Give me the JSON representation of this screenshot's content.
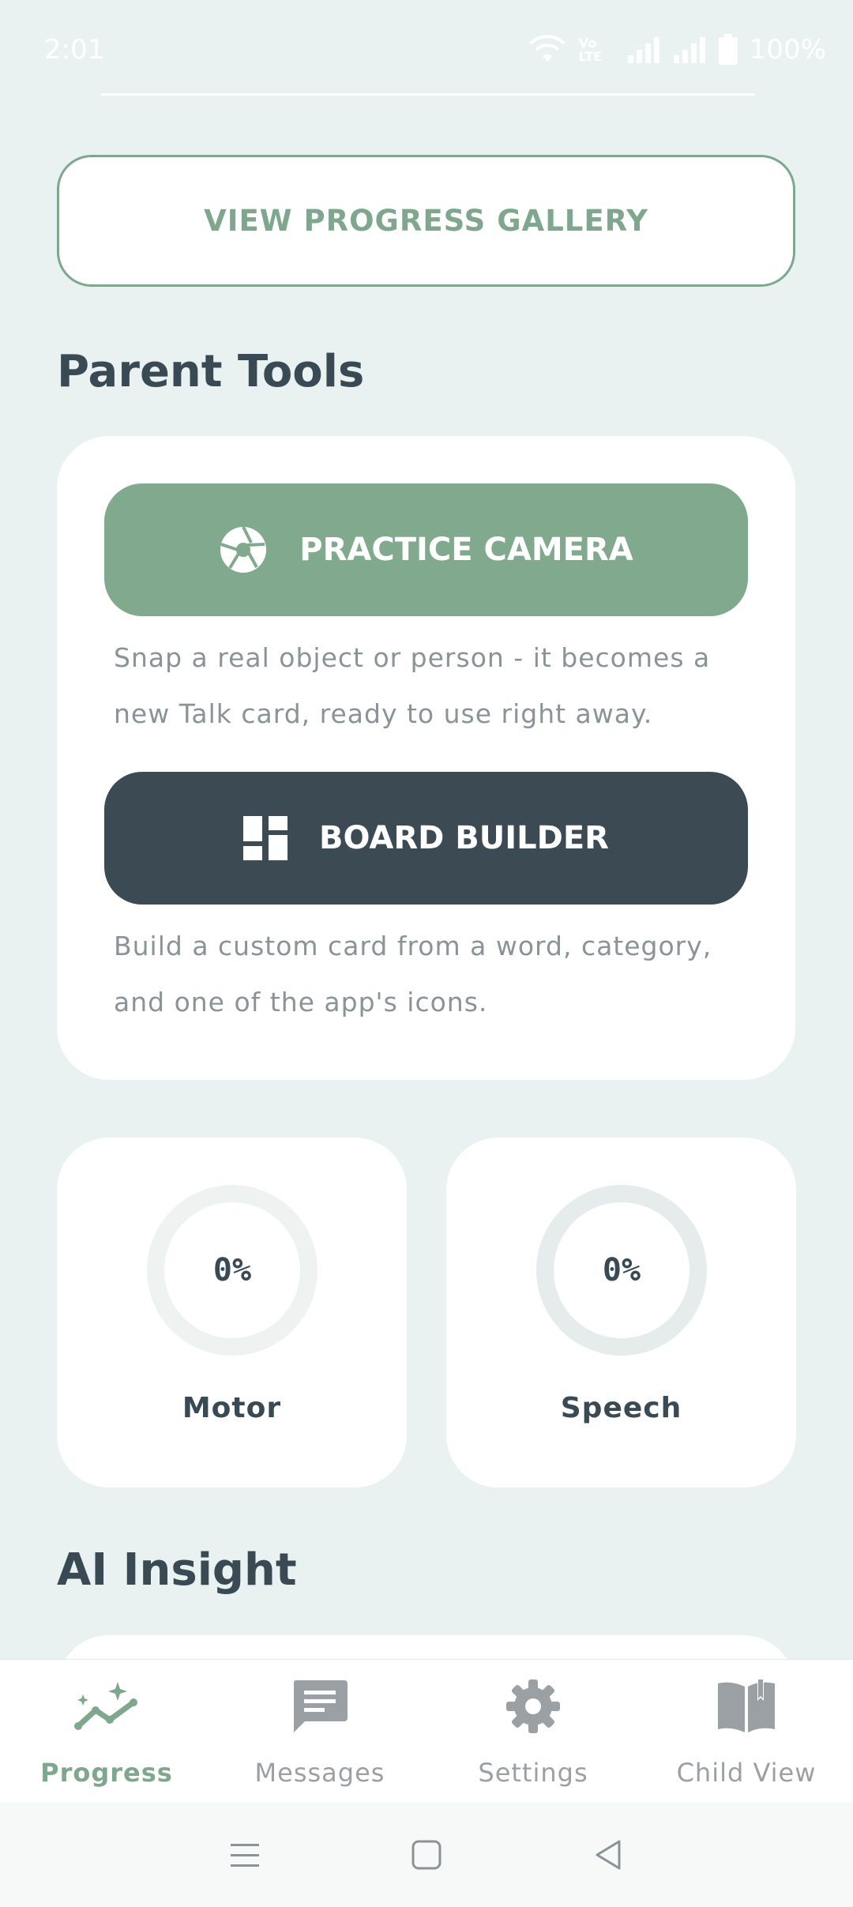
{
  "status_bar": {
    "time": "2:01",
    "network": "Vo LTE",
    "battery": "100%"
  },
  "gallery_button": {
    "label": "VIEW PROGRESS GALLERY"
  },
  "parent_tools": {
    "title": "Parent Tools",
    "camera": {
      "label": "PRACTICE CAMERA",
      "description": "Snap a real object or person - it becomes a new Talk card, ready to use right away."
    },
    "builder": {
      "label": "BOARD BUILDER",
      "description": "Build a custom card from a word, category, and one of the app's icons."
    }
  },
  "metrics": [
    {
      "name": "Motor",
      "value": "0%",
      "progress": 0
    },
    {
      "name": "Speech",
      "value": "0%",
      "progress": 0
    }
  ],
  "ai_insight": {
    "title": "AI Insight"
  },
  "bottom_nav": {
    "items": [
      {
        "label": "Progress",
        "icon": "sparkle-trend-icon",
        "active": true
      },
      {
        "label": "Messages",
        "icon": "message-icon",
        "active": false
      },
      {
        "label": "Settings",
        "icon": "gear-icon",
        "active": false
      },
      {
        "label": "Child View",
        "icon": "book-icon",
        "active": false
      }
    ]
  },
  "colors": {
    "background": "#e9f1f1",
    "accent_green": "#7fa78d",
    "dark_slate": "#3c4a54",
    "muted_text": "#8a9398"
  }
}
